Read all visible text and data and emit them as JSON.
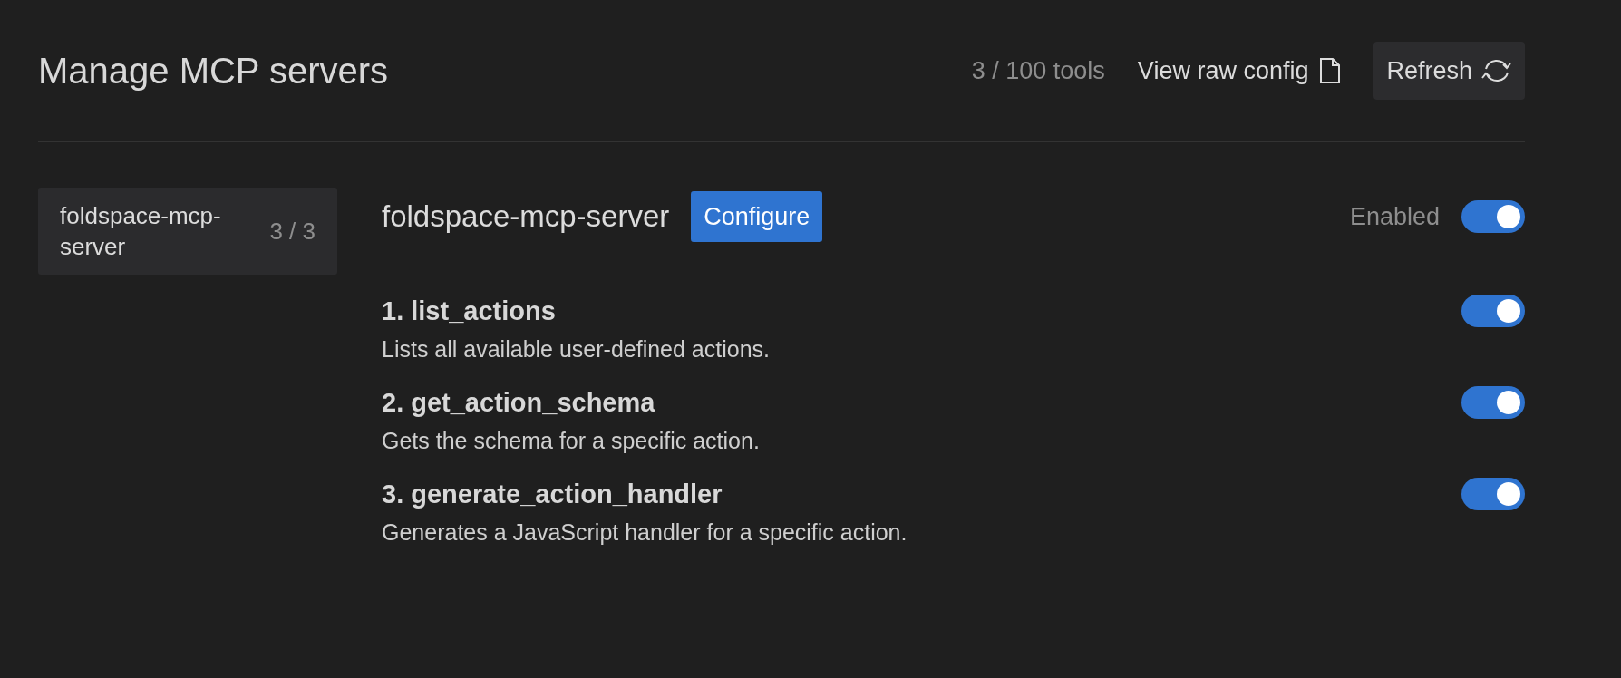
{
  "header": {
    "title": "Manage MCP servers",
    "tool_count": "3 / 100 tools",
    "view_config": "View raw config",
    "refresh": "Refresh"
  },
  "sidebar": {
    "items": [
      {
        "name": "foldspace-mcp-server",
        "count": "3 / 3",
        "selected": true
      }
    ]
  },
  "server": {
    "name": "foldspace-mcp-server",
    "configure": "Configure",
    "enabled_label": "Enabled",
    "enabled": true
  },
  "tools": [
    {
      "name": "1. list_actions",
      "description": "Lists all available user-defined actions.",
      "on": true
    },
    {
      "name": "2. get_action_schema",
      "description": "Gets the schema for a specific action.",
      "on": true
    },
    {
      "name": "3. generate_action_handler",
      "description": "Generates a JavaScript handler for a specific action.",
      "on": true
    }
  ]
}
